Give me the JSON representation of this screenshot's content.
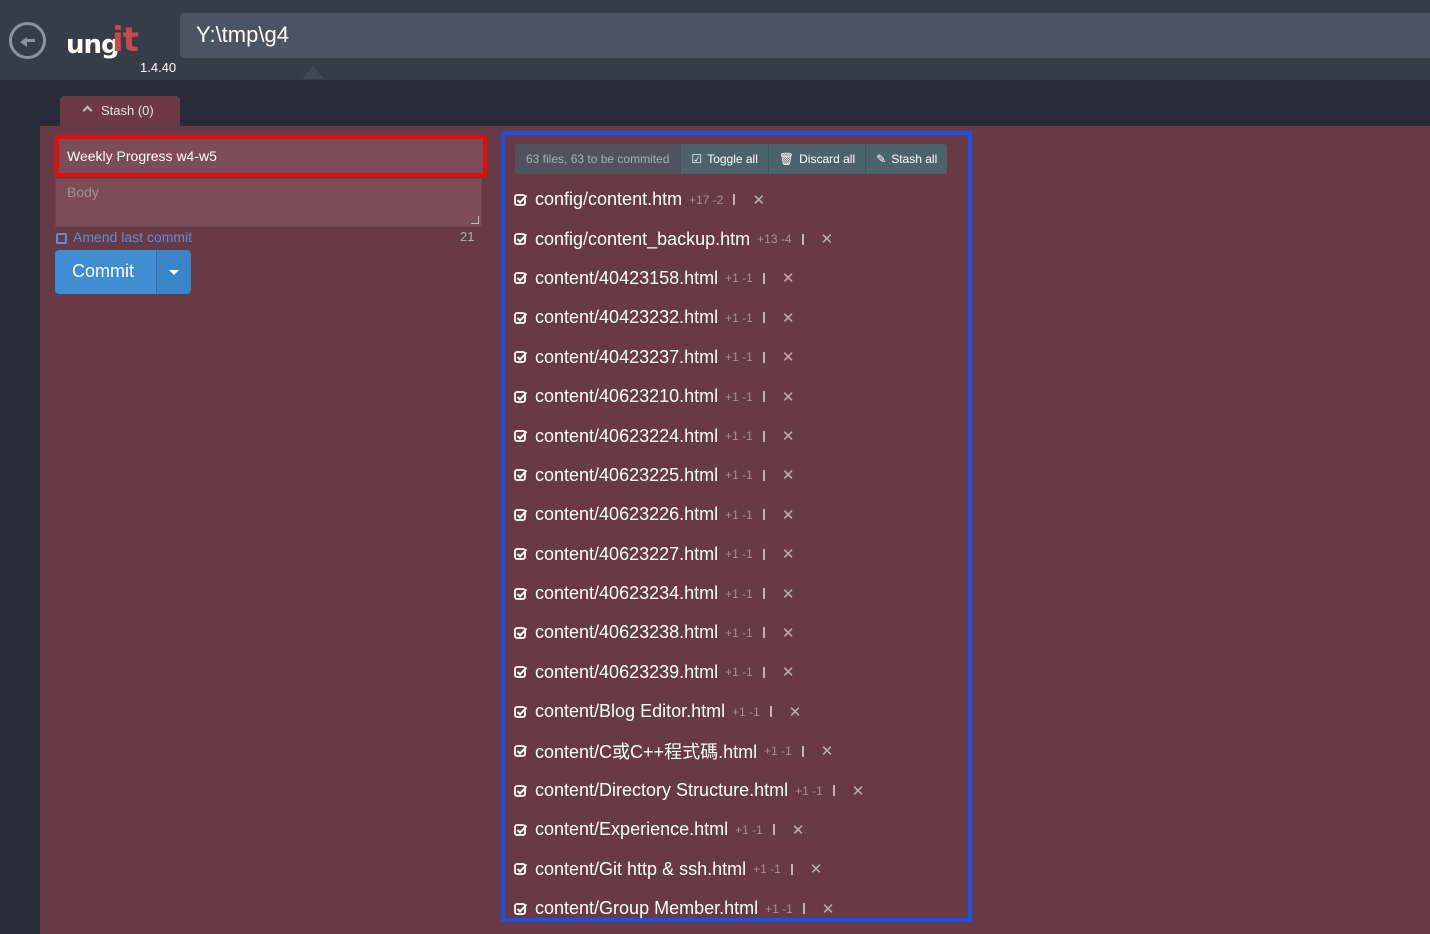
{
  "app": {
    "path": "Y:\\tmp\\g4",
    "version": "1.4.40",
    "logo_left": "ung",
    "logo_right": "it"
  },
  "stash": {
    "label": "Stash (0)"
  },
  "commit_form": {
    "title_value": "Weekly Progress w4-w5",
    "body_placeholder": "Body",
    "amend_label": "Amend last commit",
    "char_count": "21",
    "commit_label": "Commit"
  },
  "toolbar": {
    "summary": "63 files, 63 to be commited",
    "toggle_all": "Toggle all",
    "discard_all": "Discard all",
    "stash_all": "Stash all"
  },
  "files": [
    {
      "name": "config/content.htm",
      "stats": "+17 -2"
    },
    {
      "name": "config/content_backup.htm",
      "stats": "+13 -4"
    },
    {
      "name": "content/40423158.html",
      "stats": "+1 -1"
    },
    {
      "name": "content/40423232.html",
      "stats": "+1 -1"
    },
    {
      "name": "content/40423237.html",
      "stats": "+1 -1"
    },
    {
      "name": "content/40623210.html",
      "stats": "+1 -1"
    },
    {
      "name": "content/40623224.html",
      "stats": "+1 -1"
    },
    {
      "name": "content/40623225.html",
      "stats": "+1 -1"
    },
    {
      "name": "content/40623226.html",
      "stats": "+1 -1"
    },
    {
      "name": "content/40623227.html",
      "stats": "+1 -1"
    },
    {
      "name": "content/40623234.html",
      "stats": "+1 -1"
    },
    {
      "name": "content/40623238.html",
      "stats": "+1 -1"
    },
    {
      "name": "content/40623239.html",
      "stats": "+1 -1"
    },
    {
      "name": "content/Blog Editor.html",
      "stats": "+1 -1"
    },
    {
      "name": "content/C或C++程式碼.html",
      "stats": "+1 -1"
    },
    {
      "name": "content/Directory Structure.html",
      "stats": "+1 -1"
    },
    {
      "name": "content/Experience.html",
      "stats": "+1 -1"
    },
    {
      "name": "content/Git http & ssh.html",
      "stats": "+1 -1"
    },
    {
      "name": "content/Group Member.html",
      "stats": "+1 -1"
    }
  ],
  "colors": {
    "header_bg": "#353d48",
    "panel_bg": "#673a46",
    "commit_blue": "#3f8ed4",
    "highlight_red": "#e50c0c",
    "highlight_blue": "#1a52e6"
  }
}
